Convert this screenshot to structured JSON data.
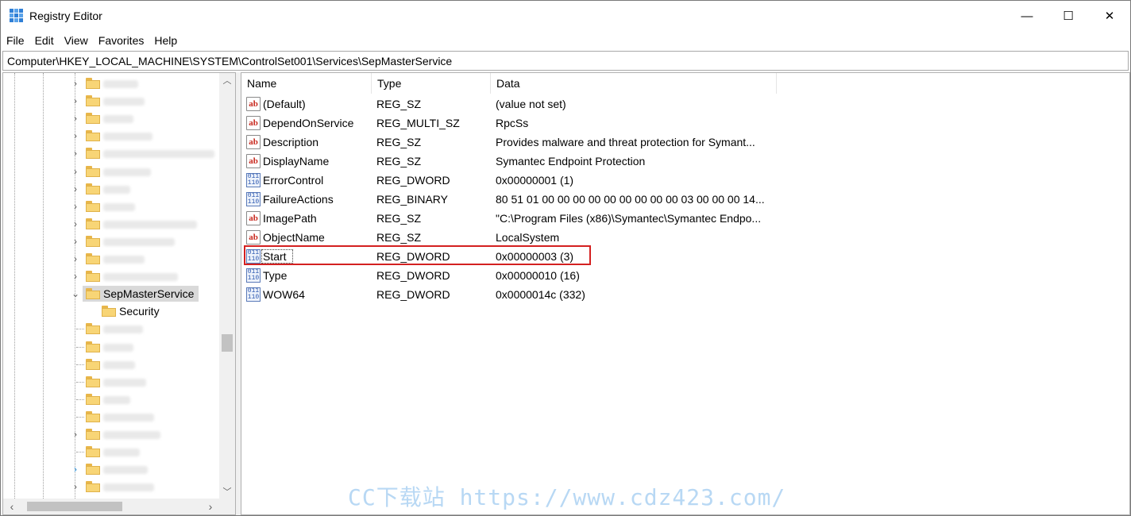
{
  "window": {
    "title": "Registry Editor",
    "app_icon": "registry-editor-icon",
    "controls": {
      "minimize": "—",
      "maximize": "☐",
      "close": "✕"
    }
  },
  "menu": [
    "File",
    "Edit",
    "View",
    "Favorites",
    "Help"
  ],
  "address": "Computer\\HKEY_LOCAL_MACHINE\\SYSTEM\\ControlSet001\\Services\\SepMasterService",
  "tree": {
    "selected": "SepMasterService",
    "child": "Security"
  },
  "list": {
    "columns": [
      "Name",
      "Type",
      "Data"
    ],
    "rows": [
      {
        "icon": "string-value-icon",
        "name": "(Default)",
        "type": "REG_SZ",
        "data": "(value not set)"
      },
      {
        "icon": "string-value-icon",
        "name": "DependOnService",
        "type": "REG_MULTI_SZ",
        "data": "RpcSs"
      },
      {
        "icon": "string-value-icon",
        "name": "Description",
        "type": "REG_SZ",
        "data": "Provides malware and threat protection for Symant..."
      },
      {
        "icon": "string-value-icon",
        "name": "DisplayName",
        "type": "REG_SZ",
        "data": "Symantec Endpoint Protection"
      },
      {
        "icon": "binary-value-icon",
        "name": "ErrorControl",
        "type": "REG_DWORD",
        "data": "0x00000001 (1)"
      },
      {
        "icon": "binary-value-icon",
        "name": "FailureActions",
        "type": "REG_BINARY",
        "data": "80 51 01 00 00 00 00 00 00 00 00 00 03 00 00 00 14..."
      },
      {
        "icon": "string-value-icon",
        "name": "ImagePath",
        "type": "REG_SZ",
        "data": "\"C:\\Program Files (x86)\\Symantec\\Symantec Endpo..."
      },
      {
        "icon": "string-value-icon",
        "name": "ObjectName",
        "type": "REG_SZ",
        "data": "LocalSystem"
      },
      {
        "icon": "binary-value-icon",
        "name": "Start",
        "type": "REG_DWORD",
        "data": "0x00000003 (3)"
      },
      {
        "icon": "binary-value-icon",
        "name": "Type",
        "type": "REG_DWORD",
        "data": "0x00000010 (16)"
      },
      {
        "icon": "binary-value-icon",
        "name": "WOW64",
        "type": "REG_DWORD",
        "data": "0x0000014c (332)"
      }
    ]
  },
  "watermark": "CC下载站 https://www.cdz423.com/",
  "colors": {
    "highlight": "#d42020",
    "folder": "#f8d576",
    "selection": "#d9d9d9"
  }
}
